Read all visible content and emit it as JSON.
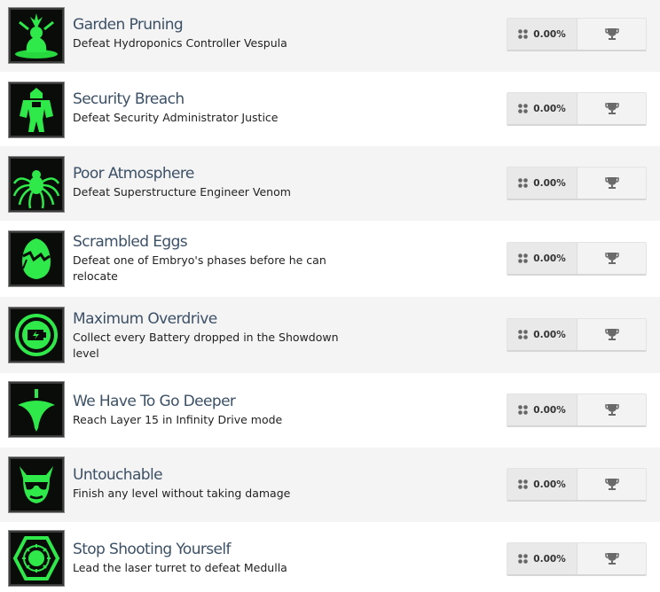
{
  "achievements": [
    {
      "title": "Garden Pruning",
      "description": "Defeat Hydroponics Controller Vespula",
      "percent": "0.00%",
      "icon": "plant-creature-icon"
    },
    {
      "title": "Security Breach",
      "description": "Defeat Security Administrator Justice",
      "percent": "0.00%",
      "icon": "robot-guard-icon"
    },
    {
      "title": "Poor Atmosphere",
      "description": "Defeat Superstructure Engineer Venom",
      "percent": "0.00%",
      "icon": "spider-icon"
    },
    {
      "title": "Scrambled Eggs",
      "description": "Defeat one of Embryo's phases before he can relocate",
      "percent": "0.00%",
      "icon": "cracked-egg-icon"
    },
    {
      "title": "Maximum Overdrive",
      "description": "Collect every Battery dropped in the Showdown level",
      "percent": "0.00%",
      "icon": "battery-icon"
    },
    {
      "title": "We Have To Go Deeper",
      "description": "Reach Layer 15 in Infinity Drive mode",
      "percent": "0.00%",
      "icon": "spinning-top-icon"
    },
    {
      "title": "Untouchable",
      "description": "Finish any level without taking damage",
      "percent": "0.00%",
      "icon": "sunglasses-face-icon"
    },
    {
      "title": "Stop Shooting Yourself",
      "description": "Lead the laser turret to defeat Medulla",
      "percent": "0.00%",
      "icon": "turret-icon"
    }
  ],
  "colors": {
    "accent_green": "#2fe84a",
    "title_color": "#3c5066"
  }
}
